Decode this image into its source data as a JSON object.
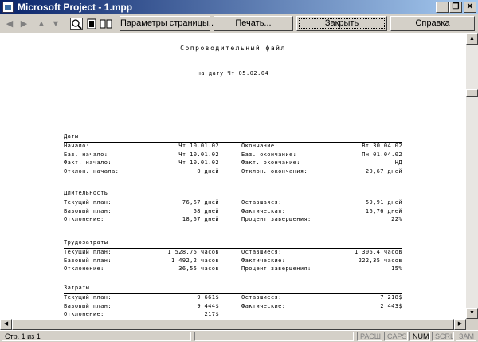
{
  "window": {
    "title": "Microsoft Project - 1.mpp"
  },
  "toolbar": {
    "page_setup_label": "Параметры страницы...",
    "print_label": "Печать...",
    "close_label": "Закрыть",
    "help_label": "Справка"
  },
  "document": {
    "title": "Сопроводительный файл",
    "date_line": "на дату Чт 05.02.04",
    "sections": [
      {
        "heading": "Даты",
        "rows": [
          {
            "l1": "Начало:",
            "v1": "Чт 10.01.02",
            "l2": "Окончание:",
            "v2": "Вт 30.04.02"
          },
          {
            "l1": "Баз. начало:",
            "v1": "Чт 10.01.02",
            "l2": "Баз. окончание:",
            "v2": "Пн 01.04.02"
          },
          {
            "l1": "Факт. начало:",
            "v1": "Чт 10.01.02",
            "l2": "Факт. окончание:",
            "v2": "НД"
          },
          {
            "l1": "Отклон. начала:",
            "v1": "0 дней",
            "l2": "Отклон. окончания:",
            "v2": "20,67 дней"
          }
        ]
      },
      {
        "heading": "Длительность",
        "rows": [
          {
            "l1": "Текущий план:",
            "v1": "76,67 дней",
            "l2": "Оставшаяся:",
            "v2": "59,91 дней"
          },
          {
            "l1": "Базовый план:",
            "v1": "58 дней",
            "l2": "Фактическая:",
            "v2": "16,76 дней"
          },
          {
            "l1": "Отклонение:",
            "v1": "18,67 дней",
            "l2": "Процент завершения:",
            "v2": "22%"
          }
        ]
      },
      {
        "heading": "Трудозатраты",
        "rows": [
          {
            "l1": "Текущий план:",
            "v1": "1 528,75 часов",
            "l2": "Оставшиеся:",
            "v2": "1 306,4 часов"
          },
          {
            "l1": "Базовый план:",
            "v1": "1 492,2 часов",
            "l2": "Фактические:",
            "v2": "222,35 часов"
          },
          {
            "l1": "Отклонение:",
            "v1": "36,55 часов",
            "l2": "Процент завершения:",
            "v2": "15%"
          }
        ]
      },
      {
        "heading": "Затраты",
        "rows": [
          {
            "l1": "Текущий план:",
            "v1": "9 661$",
            "l2": "Оставшиеся:",
            "v2": "7 218$"
          },
          {
            "l1": "Базовый план:",
            "v1": "9 444$",
            "l2": "Фактические:",
            "v2": "2 443$"
          },
          {
            "l1": "Отклонение:",
            "v1": "217$",
            "l2": "",
            "v2": ""
          }
        ]
      }
    ]
  },
  "statusbar": {
    "page_info": "Стр. 1 из 1",
    "ext": "РАСШ",
    "caps": "CAPS",
    "num": "NUM",
    "scrl": "SCRL",
    "ovr": "ЗАМ"
  }
}
